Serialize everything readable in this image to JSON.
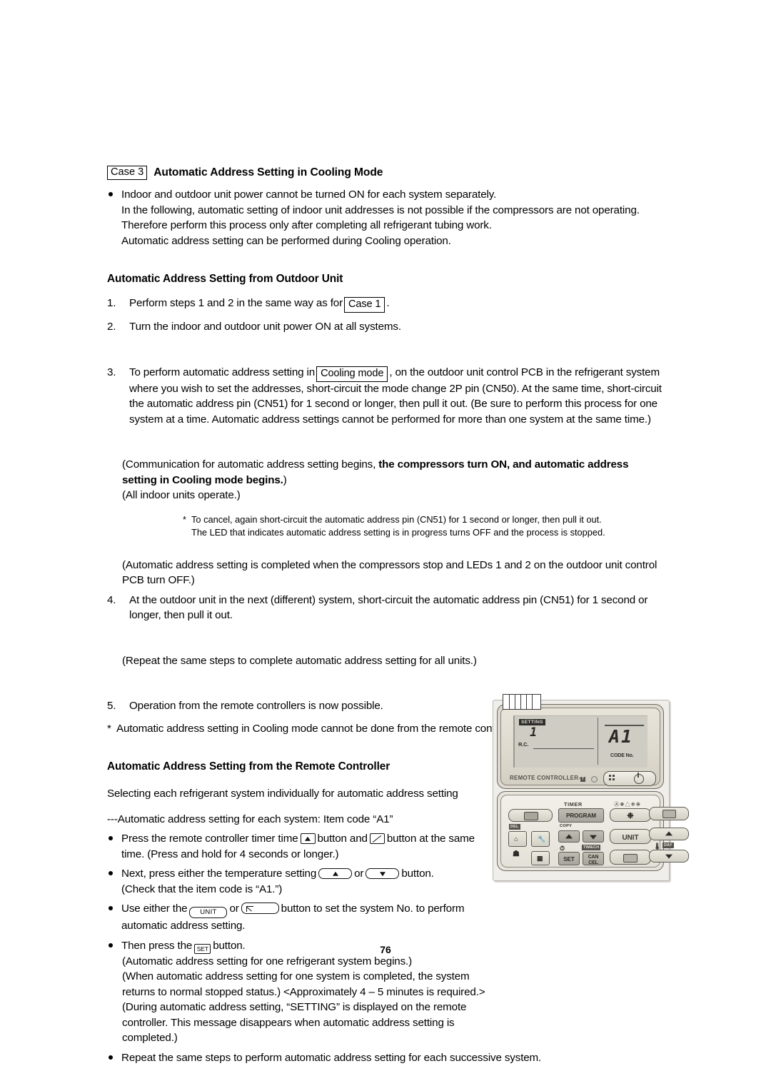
{
  "page": {
    "number": "76"
  },
  "case_header": {
    "box_label": "Case 3",
    "title": "Automatic Address Setting in Cooling Mode"
  },
  "intro_bullet": {
    "line1": "Indoor and outdoor unit power cannot be turned ON for each system separately.",
    "line2": "In the following, automatic setting of indoor unit addresses is not possible if the compressors are not operating.",
    "line3": "Therefore perform this process only after completing all refrigerant tubing work.",
    "line4": "Automatic address setting can be performed during Cooling operation."
  },
  "outdoor_section": {
    "heading": "Automatic Address Setting from Outdoor Unit",
    "step1": {
      "num": "1.",
      "text_before": "Perform steps 1 and 2 in the same way as for",
      "box_label": "Case 1",
      "text_after": "."
    },
    "step2": {
      "num": "2.",
      "text": "Turn the indoor and outdoor unit power ON at all systems."
    },
    "step3": {
      "num": "3.",
      "text_before": "To perform automatic address setting in",
      "box_label": "Cooling mode",
      "text_after": ", on the outdoor unit control PCB in the refrigerant system",
      "line2": "where you wish to set the addresses, short-circuit the mode change 2P pin (CN50). At the same time, short-circuit",
      "line3": "the automatic address pin (CN51) for 1 second or longer, then pull it out. (Be sure to perform this process for one",
      "line4": "system at a time. Automatic address settings cannot be performed for more than one system at the same time.)"
    },
    "note_block": {
      "line1_normal": "(Communication for automatic address setting begins, ",
      "line1_bold": "the compressors turn ON, and automatic address",
      "line2_bold": "setting in Cooling mode begins.",
      "line2_normal": ")",
      "line3": "(All indoor units operate.)"
    },
    "footnote": {
      "star": "*",
      "line1": "To cancel, again short-circuit the automatic address pin (CN51) for 1 second or longer, then pull it out.",
      "line2": "The LED that indicates automatic address setting is in progress turns OFF and the process is stopped."
    },
    "completion_note": {
      "line1": "(Automatic address setting is completed when the compressors stop and LEDs 1 and 2 on the outdoor unit control",
      "line2": "PCB turn OFF.)"
    },
    "step4": {
      "num": "4.",
      "line1": "At the outdoor unit in the next (different) system, short-circuit the automatic address pin (CN51) for 1 second or",
      "line2": "longer, then pull it out."
    },
    "repeat_note": "(Repeat the same steps to complete automatic address setting for all units.)",
    "step5": {
      "num": "5.",
      "text": "Operation from the remote controllers is now possible."
    },
    "star_note": {
      "star": "*",
      "text": "Automatic address setting in Cooling mode cannot be done from the remote controller."
    }
  },
  "remote_section": {
    "heading": "Automatic Address Setting from the Remote Controller",
    "subtitle": "Selecting each refrigerant system individually for automatic address setting",
    "dash_line": "---Automatic address setting for each system: Item code “A1”",
    "bullet1": {
      "part1": "Press the remote controller timer time",
      "key1": "timer-up-key",
      "part2": "button and",
      "key2": "vent-key",
      "part3": "button at the same",
      "line2": "time. (Press and hold for 4 seconds or longer.)"
    },
    "bullet2": {
      "part1": "Next, press either the temperature setting",
      "key1": "temp-up-key",
      "part2": "or",
      "key2": "temp-down-key",
      "part3": "button.",
      "line2": "(Check that the item code is “A1.”)"
    },
    "bullet3": {
      "part1": "Use either the",
      "key1": "UNIT",
      "part2": "or",
      "key2": "flow-key",
      "part3": "button to set the system No. to perform",
      "line2": "automatic address setting."
    },
    "bullet4": {
      "part1": "Then press the",
      "key1": "SET",
      "part2": "button."
    },
    "paren_notes": {
      "line1": "(Automatic address setting for one refrigerant system begins.)",
      "line2": "(When automatic address setting for one system is completed, the system",
      "line3": "returns to normal stopped status.) <Approximately 4 – 5 minutes is required.>",
      "line4": "(During automatic address setting, “SETTING” is displayed on the remote",
      "line5": "controller. This message disappears when automatic address setting is",
      "line6": "completed.)"
    },
    "bullet5": "Repeat the same steps to perform automatic address setting for each successive system."
  },
  "remote_controller": {
    "display": {
      "setting_badge": "SETTING",
      "system_number": "1",
      "rc_label": "R.C.",
      "code_value": "A1",
      "code_label": "CODE No."
    },
    "brand": {
      "text": "REMOTE CONTROLLER-",
      "mark": "T"
    },
    "keypad": {
      "timer_label": "TIMER",
      "mode_icons": "Ⓐ❅△❄❉",
      "program_label": "PROGRAM",
      "copy_label": "COPY",
      "del_label": "DEL",
      "set_label": "SET",
      "cancel_label": "CAN\nCEL",
      "unit_label": "UNIT",
      "day_label": "DAY",
      "time_label": "TIME",
      "check_label": "CH"
    }
  }
}
